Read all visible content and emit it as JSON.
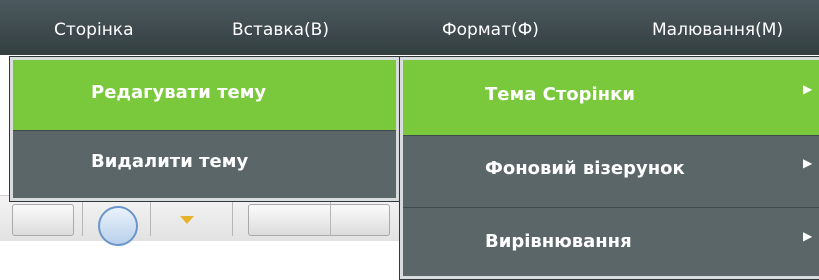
{
  "menubar": {
    "items": [
      {
        "label": "Сторінка"
      },
      {
        "label": "Вставка(В)"
      },
      {
        "label": "Формат(Ф)"
      },
      {
        "label": "Малювання(М)"
      }
    ]
  },
  "submenu_left": {
    "items": [
      {
        "label": "Редагувати тему",
        "active": true
      },
      {
        "label": "Видалити тему",
        "active": false
      }
    ]
  },
  "submenu_right": {
    "items": [
      {
        "label": "Тема Сторінки",
        "active": true,
        "has_submenu": true
      },
      {
        "label": "Фоновий візерунок",
        "active": false,
        "has_submenu": true
      },
      {
        "label": "Вирівнювання",
        "active": false,
        "has_submenu": true
      }
    ]
  },
  "colors": {
    "menubar_bg": "#3e4a4e",
    "menu_bg": "#5a6668",
    "active_bg": "#7ac93d",
    "text": "#ffffff"
  },
  "icons": {
    "submenu_arrow": "chevron-right-icon"
  }
}
